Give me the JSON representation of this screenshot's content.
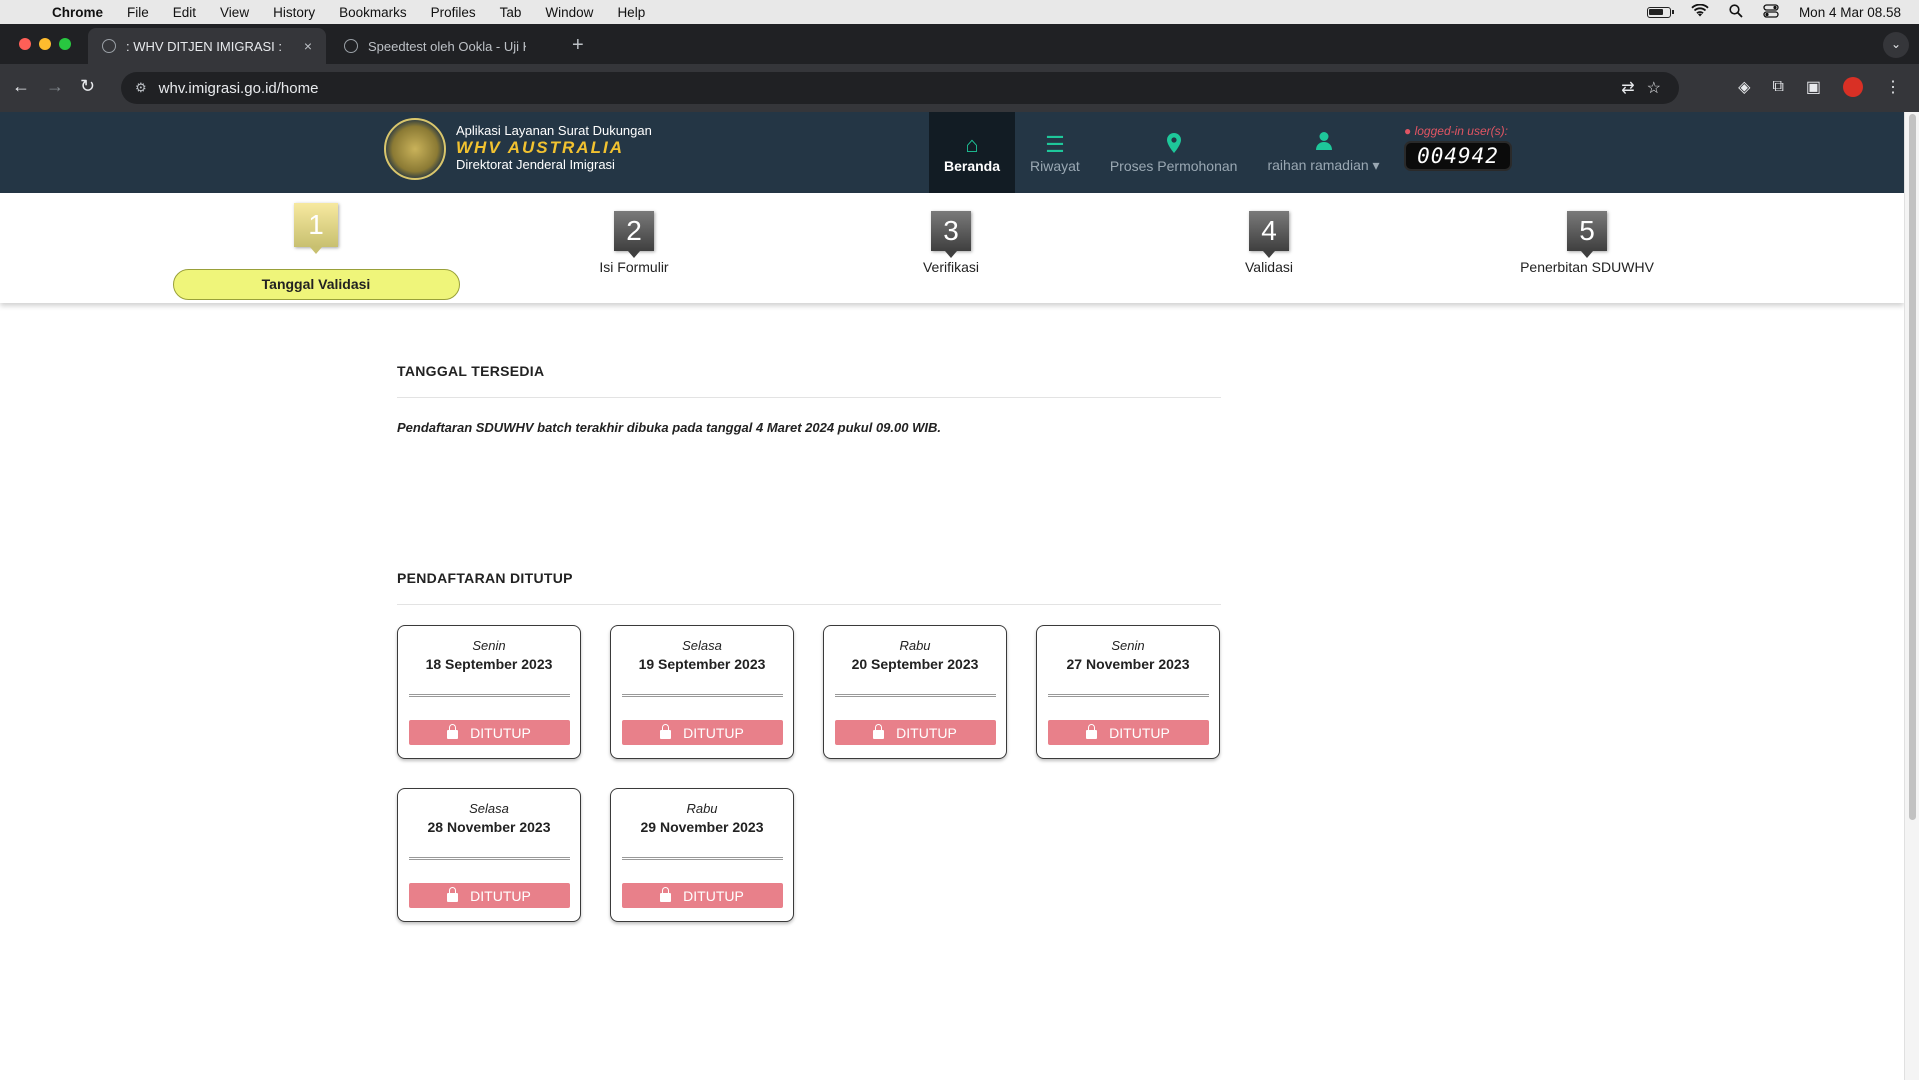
{
  "menubar": {
    "app": "Chrome",
    "items": [
      "File",
      "Edit",
      "View",
      "History",
      "Bookmarks",
      "Profiles",
      "Tab",
      "Window",
      "Help"
    ],
    "clock": "Mon 4 Mar  08.58"
  },
  "tabs": [
    {
      "title": ": WHV DITJEN IMIGRASI :",
      "close": "×"
    },
    {
      "title": "Speedtest oleh Ookla - Uji Ke"
    }
  ],
  "newtab_label": "+",
  "address": {
    "url": "whv.imigrasi.go.id/home"
  },
  "site": {
    "brand_line1": "Aplikasi Layanan Surat Dukungan",
    "brand_line2": "WHV AUSTRALIA",
    "brand_line3": "Direktorat Jenderal Imigrasi",
    "nav": [
      {
        "label": "Beranda",
        "icon": "home-icon"
      },
      {
        "label": "Riwayat",
        "icon": "list-icon"
      },
      {
        "label": "Proses Permohonan",
        "icon": "map-marker-icon"
      },
      {
        "label": "raihan ramadian ▾",
        "icon": "user-icon"
      }
    ],
    "logged_in_label": "logged-in user(s):",
    "logged_in_count": "004942"
  },
  "steps": [
    {
      "num": "1",
      "label": "Tanggal  Validasi",
      "active": true
    },
    {
      "num": "2",
      "label": "Isi Formulir"
    },
    {
      "num": "3",
      "label": "Verifikasi"
    },
    {
      "num": "4",
      "label": "Validasi"
    },
    {
      "num": "5",
      "label": "Penerbitan SDUWHV"
    }
  ],
  "available": {
    "title": "TANGGAL TERSEDIA",
    "notice": "Pendaftaran SDUWHV batch terakhir dibuka pada tanggal 4 Maret 2024 pukul 09.00 WIB."
  },
  "closed": {
    "title": "PENDAFTARAN DITUTUP",
    "button_label": "DITUTUP",
    "cards": [
      {
        "day": "Senin",
        "date": "18 September 2023"
      },
      {
        "day": "Selasa",
        "date": "19 September 2023"
      },
      {
        "day": "Rabu",
        "date": "20 September 2023"
      },
      {
        "day": "Senin",
        "date": "27 November 2023"
      },
      {
        "day": "Selasa",
        "date": "28 November 2023"
      },
      {
        "day": "Rabu",
        "date": "29 November 2023"
      }
    ]
  },
  "colors": {
    "header_bg": "#243645",
    "accent": "#1ec79a",
    "closed_button": "#e8808a",
    "active_step": "#eff57a"
  }
}
